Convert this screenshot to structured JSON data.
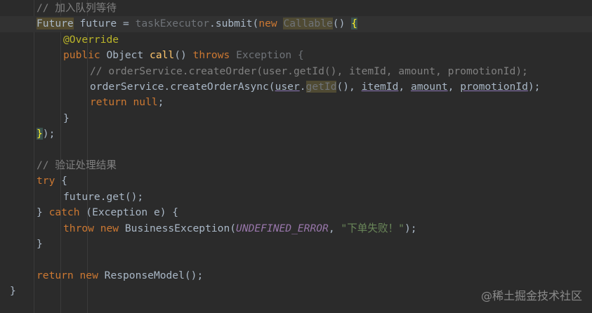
{
  "editor": {
    "lines": [
      {
        "indent": 1,
        "tokens": [
          [
            "cm",
            "// 加入队列等待"
          ]
        ]
      },
      {
        "indent": 1,
        "current": true,
        "tokens": [
          [
            "hl",
            "Future"
          ],
          [
            "id",
            " future = "
          ],
          [
            "dim",
            "taskExecutor"
          ],
          [
            "id",
            ".submit("
          ],
          [
            "kw",
            "new "
          ],
          [
            "hl2",
            "Callable"
          ],
          [
            "id",
            "() "
          ],
          [
            "brace",
            "{"
          ]
        ]
      },
      {
        "indent": 2,
        "tokens": [
          [
            "an",
            "@Override"
          ]
        ]
      },
      {
        "indent": 2,
        "tokens": [
          [
            "kw",
            "public "
          ],
          [
            "id",
            "Object "
          ],
          [
            "fn",
            "call"
          ],
          [
            "id",
            "() "
          ],
          [
            "kw",
            "throws "
          ],
          [
            "dim",
            "Exception {"
          ]
        ]
      },
      {
        "indent": 3,
        "tokens": [
          [
            "cm",
            "// orderService.createOrder(user.getId(), itemId, amount, promotionId);"
          ]
        ]
      },
      {
        "indent": 3,
        "tokens": [
          [
            "id",
            "orderService.createOrderAsync("
          ],
          [
            "param",
            "user"
          ],
          [
            "id",
            "."
          ],
          [
            "hl2",
            "getId"
          ],
          [
            "id",
            "(), "
          ],
          [
            "param",
            "itemId"
          ],
          [
            "id",
            ", "
          ],
          [
            "param",
            "amount"
          ],
          [
            "id",
            ", "
          ],
          [
            "param",
            "promotionId"
          ],
          [
            "id",
            ");"
          ]
        ]
      },
      {
        "indent": 3,
        "tokens": [
          [
            "kw",
            "return null"
          ],
          [
            "id",
            ";"
          ]
        ]
      },
      {
        "indent": 2,
        "tokens": [
          [
            "id",
            "}"
          ]
        ]
      },
      {
        "indent": 1,
        "tokens": [
          [
            "brace",
            "}"
          ],
          [
            "id",
            ");"
          ]
        ]
      },
      {
        "indent": 0,
        "tokens": []
      },
      {
        "indent": 1,
        "tokens": [
          [
            "cm",
            "// 验证处理结果"
          ]
        ]
      },
      {
        "indent": 1,
        "tokens": [
          [
            "kw",
            "try "
          ],
          [
            "id",
            "{"
          ]
        ]
      },
      {
        "indent": 2,
        "tokens": [
          [
            "id",
            "future.get();"
          ]
        ]
      },
      {
        "indent": 1,
        "tokens": [
          [
            "id",
            "} "
          ],
          [
            "kw",
            "catch "
          ],
          [
            "id",
            "(Exception e) {"
          ]
        ]
      },
      {
        "indent": 2,
        "tokens": [
          [
            "kw",
            "throw new "
          ],
          [
            "id",
            "BusinessException("
          ],
          [
            "const",
            "UNDEFINED_ERROR"
          ],
          [
            "id",
            ", "
          ],
          [
            "str",
            "\"下单失败！\""
          ],
          [
            "id",
            ");"
          ]
        ]
      },
      {
        "indent": 1,
        "tokens": [
          [
            "id",
            "}"
          ]
        ]
      },
      {
        "indent": 0,
        "tokens": []
      },
      {
        "indent": 1,
        "tokens": [
          [
            "kw",
            "return new "
          ],
          [
            "id",
            "ResponseModel();"
          ]
        ]
      },
      {
        "indent": 0,
        "tokens": [
          [
            "id",
            "}"
          ]
        ]
      }
    ]
  },
  "watermark": "@稀土掘金技术社区"
}
